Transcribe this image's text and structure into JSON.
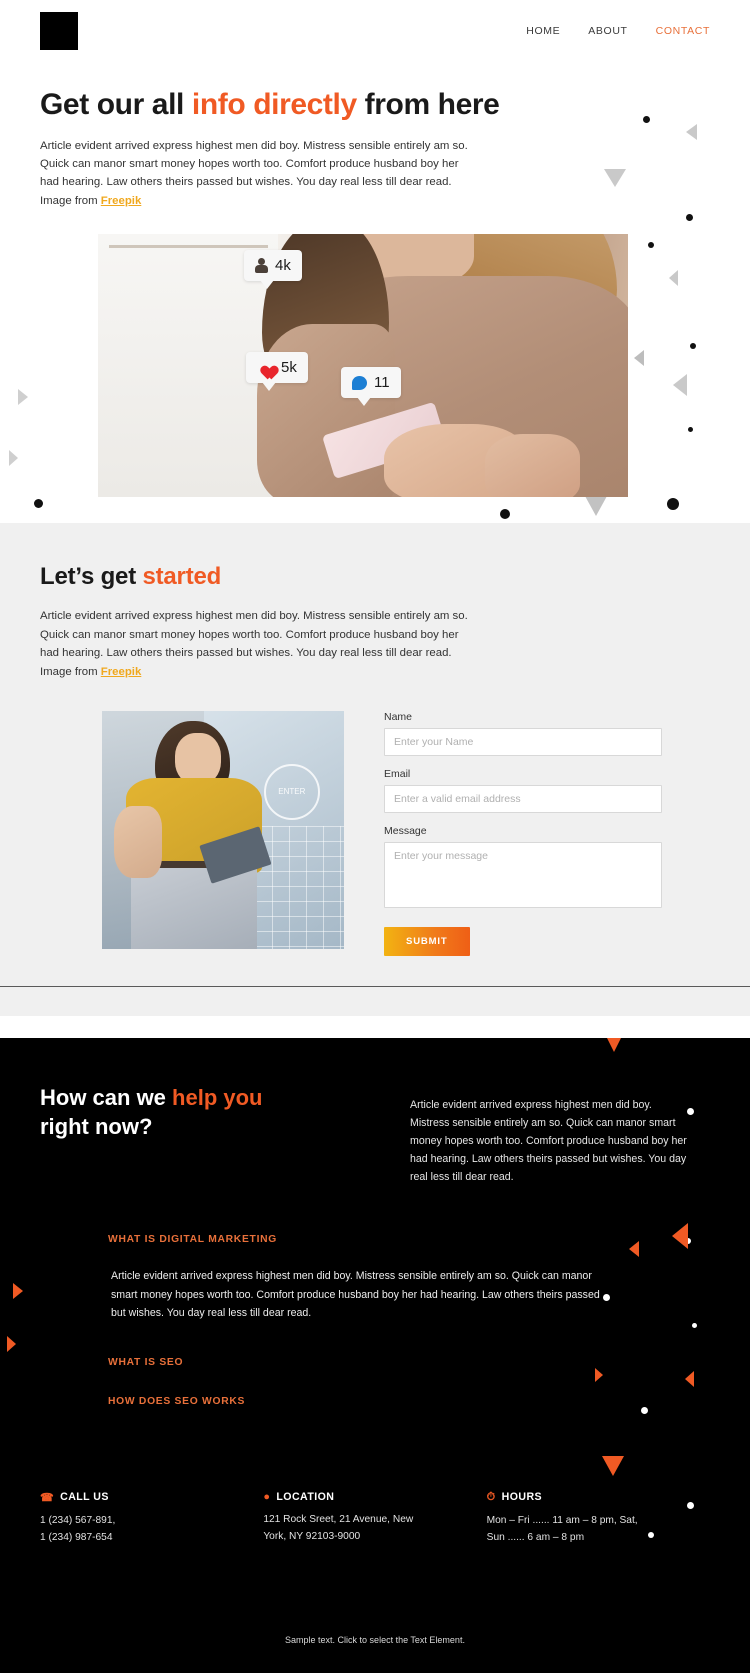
{
  "header": {
    "logo_name": "logo-mark",
    "nav": [
      {
        "label": "HOME",
        "active": false
      },
      {
        "label": "ABOUT",
        "active": false
      },
      {
        "label": "CONTACT",
        "active": true
      }
    ]
  },
  "hero": {
    "title_part1": "Get our all ",
    "title_accent": "info directly",
    "title_part2": " from here",
    "paragraph": "Article evident arrived express highest men did boy. Mistress sensible entirely am so. Quick can manor smart money hopes worth too. Comfort produce husband boy her had hearing. Law others theirs passed but wishes. You day real less till dear read. Image from ",
    "credit_link": "Freepik",
    "image_badges": [
      {
        "icon": "person-icon",
        "value": "4k"
      },
      {
        "icon": "heart-icon",
        "value": "5k"
      },
      {
        "icon": "chat-icon",
        "value": "11"
      }
    ]
  },
  "started": {
    "title_part1": "Let’s get ",
    "title_accent": "started",
    "paragraph": "Article evident arrived express highest men did boy. Mistress sensible entirely am so. Quick can manor smart money hopes worth too. Comfort produce husband boy her had hearing. Law others theirs passed but wishes. You day real less till dear read. Image from ",
    "credit_link": "Freepik",
    "photo_overlay_text": "ENTER",
    "form": {
      "name_label": "Name",
      "name_placeholder": "Enter your Name",
      "name_value": "",
      "email_label": "Email",
      "email_placeholder": "Enter a valid email address",
      "email_value": "",
      "message_label": "Message",
      "message_placeholder": "Enter your message",
      "message_value": "",
      "submit_label": "SUBMIT"
    }
  },
  "faq": {
    "title_part1": "How can we ",
    "title_accent": "help you",
    "title_part2": "right now?",
    "intro": "Article evident arrived express highest men did boy. Mistress sensible entirely am so. Quick can manor smart money hopes worth too. Comfort produce husband boy her had hearing. Law others theirs passed but wishes. You day real less till dear read.",
    "items": [
      {
        "head": "WHAT IS DIGITAL MARKETING",
        "body": "Article evident arrived express highest men did boy. Mistress sensible entirely am so. Quick can manor smart money hopes worth too. Comfort produce husband boy her had hearing. Law others theirs passed but wishes. You day real less till dear read.",
        "open": true
      },
      {
        "head": "WHAT IS SEO",
        "body": "",
        "open": false
      },
      {
        "head": "HOW DOES SEO WORKS",
        "body": "",
        "open": false
      }
    ]
  },
  "footer": {
    "columns": [
      {
        "icon": "phone-icon",
        "head": "CALL US",
        "body": "1 (234) 567-891,\n1 (234) 987-654"
      },
      {
        "icon": "location-pin-icon",
        "head": "LOCATION",
        "body": "121 Rock Sreet, 21 Avenue, New York, NY 92103-9000"
      },
      {
        "icon": "clock-icon",
        "head": "HOURS",
        "body": "Mon – Fri ...... 11 am – 8 pm, Sat, Sun  ...... 6 am – 8 pm"
      }
    ],
    "bottom_note": "Sample text. Click to select the Text Element."
  },
  "colors": {
    "accent_orange": "#f05a24",
    "accent_yellow": "#f0a81e",
    "nav_active": "#e8703a",
    "dark_bg": "#000000",
    "light_bg": "#f0f0f0"
  }
}
